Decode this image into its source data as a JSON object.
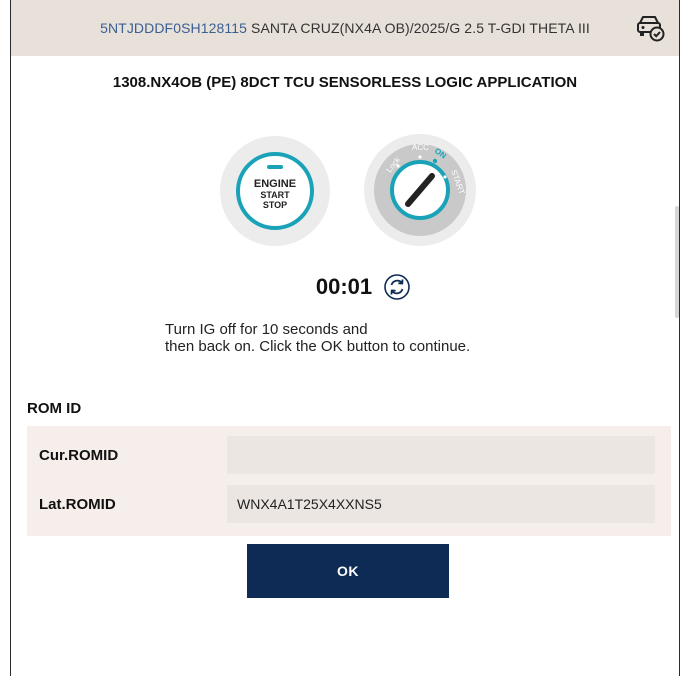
{
  "header": {
    "vin": "5NTJDDDF0SH128115",
    "vehicle": "SANTA CRUZ(NX4A OB)/2025/G 2.5 T-GDI THETA III"
  },
  "title": "1308.NX4OB (PE) 8DCT TCU SENSORLESS LOGIC APPLICATION",
  "engine_button": {
    "line1": "ENGINE",
    "line2": "START",
    "line3": "STOP"
  },
  "ignition": {
    "lock": "Lock",
    "acc": "ACC",
    "on": "ON",
    "start": "START"
  },
  "timer": "00:01",
  "instructions": {
    "line1": "Turn IG off for 10 seconds and",
    "line2": "then back on. Click the OK button to continue."
  },
  "romid": {
    "section_label": "ROM ID",
    "current": {
      "label": "Cur.ROMID",
      "value": ""
    },
    "latest": {
      "label": "Lat.ROMID",
      "value": "WNX4A1T25X4XXNS5"
    }
  },
  "ok_label": "OK",
  "colors": {
    "header_bg": "#e8e1da",
    "accent": "#1aa3b8",
    "button_bg": "#0d2b55",
    "panel_bg": "#f5eeeb"
  }
}
